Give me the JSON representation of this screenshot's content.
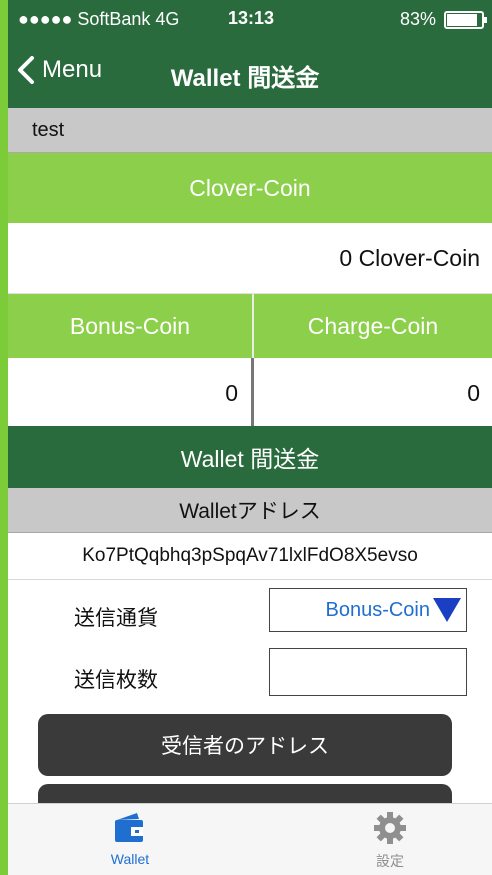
{
  "status_bar": {
    "carrier": "●●●●● SoftBank  4G",
    "time": "13:13",
    "battery": "83%"
  },
  "nav": {
    "back_label": "Menu",
    "title": "Wallet 間送金"
  },
  "account": {
    "name": "test"
  },
  "balance": {
    "header": "Clover-Coin",
    "total": "0 Clover-Coin",
    "bonus_header": "Bonus-Coin",
    "charge_header": "Charge-Coin",
    "bonus_value": "0",
    "charge_value": "0"
  },
  "transfer": {
    "section_title": "Wallet 間送金",
    "address_header": "Walletアドレス",
    "address": "Ko7PtQqbhq3pSpqAv71lxlFdO8X5evso",
    "currency_label": "送信通貨",
    "currency_value": "Bonus-Coin",
    "amount_label": "送信枚数",
    "amount_value": "",
    "recipient_button": "受信者のアドレス"
  },
  "tabbar": {
    "items": [
      {
        "label": "Wallet",
        "icon": "wallet-icon",
        "active": true
      },
      {
        "label": "設定",
        "icon": "gear-icon",
        "active": false
      }
    ]
  },
  "colors": {
    "nav_green": "#2a6b3e",
    "header_green": "#8ccf4a",
    "gray_row": "#c8c8c8",
    "accent_blue": "#1f6fd1",
    "button_dark": "#3a3a3a"
  }
}
